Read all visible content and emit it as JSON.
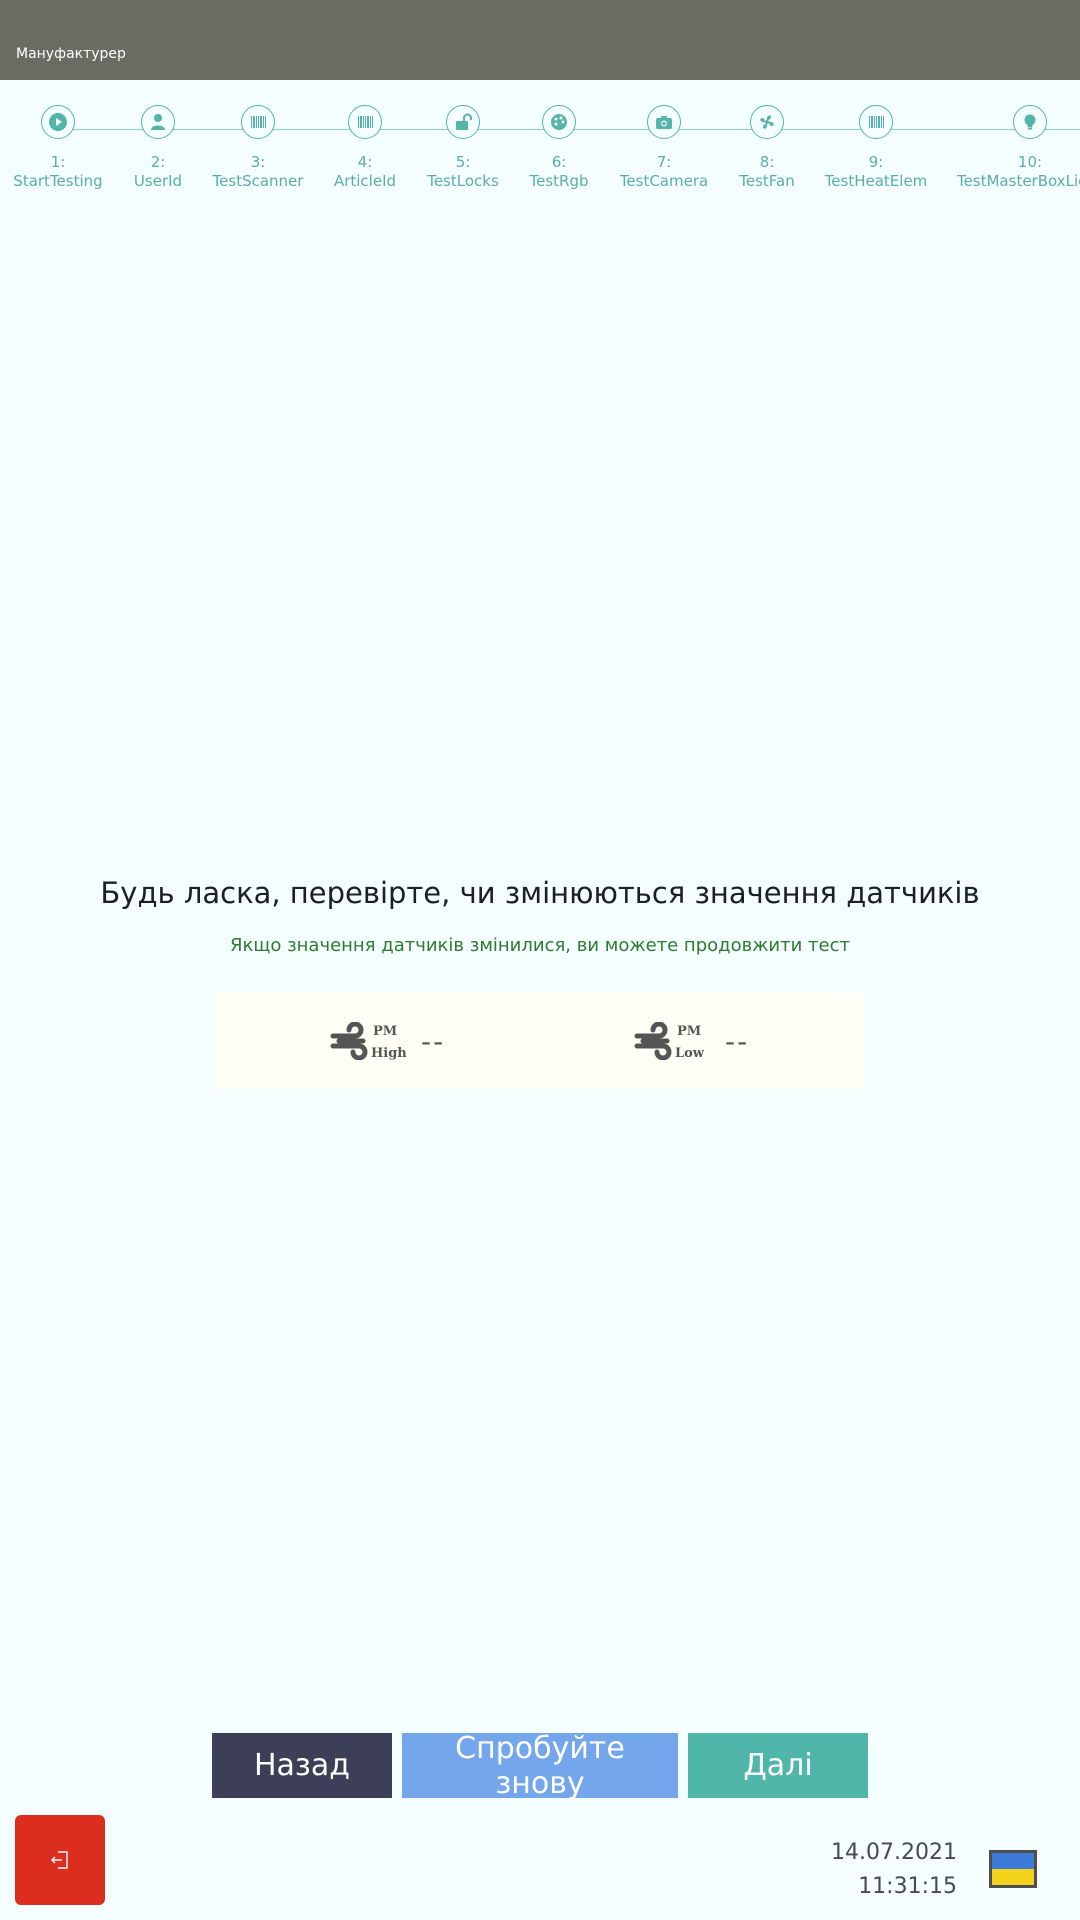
{
  "header": {
    "title": "Мануфактурер"
  },
  "stepper": {
    "steps": [
      {
        "num": "1:",
        "label": "StartTesting",
        "icon": "play-icon"
      },
      {
        "num": "2:",
        "label": "UserId",
        "icon": "user-icon"
      },
      {
        "num": "3:",
        "label": "TestScanner",
        "icon": "barcode-icon"
      },
      {
        "num": "4:",
        "label": "ArticleId",
        "icon": "barcode-icon"
      },
      {
        "num": "5:",
        "label": "TestLocks",
        "icon": "unlock-icon"
      },
      {
        "num": "6:",
        "label": "TestRgb",
        "icon": "palette-icon"
      },
      {
        "num": "7:",
        "label": "TestCamera",
        "icon": "camera-icon"
      },
      {
        "num": "8:",
        "label": "TestFan",
        "icon": "fan-icon"
      },
      {
        "num": "9:",
        "label": "TestHeatElem",
        "icon": "barcode-icon"
      },
      {
        "num": "10:",
        "label": "TestMasterBoxLight",
        "icon": "lightbulb-icon"
      }
    ]
  },
  "main": {
    "heading": "Будь ласка, перевірте, чи змінюються значення датчиків",
    "subheading": "Якщо значення датчиків змінилися, ви можете продовжити тест",
    "sensors": [
      {
        "pm": "PM",
        "sub": "High",
        "value": "--",
        "icon": "wind-icon"
      },
      {
        "pm": "PM",
        "sub": "Low",
        "value": "--",
        "icon": "wind-icon"
      }
    ]
  },
  "actions": {
    "back_label": "Назад",
    "retry_label": "Спробуйте знову",
    "next_label": "Далі"
  },
  "footer": {
    "date": "14.07.2021",
    "time": "11:31:15",
    "exit_icon": "logout-icon",
    "language_flag": "ukraine-flag-icon"
  },
  "colors": {
    "accent": "#4fb6a9",
    "back": "#3c3f57",
    "retry": "#73a6ea",
    "exit": "#dc2e1e",
    "header": "#6a6b61"
  }
}
